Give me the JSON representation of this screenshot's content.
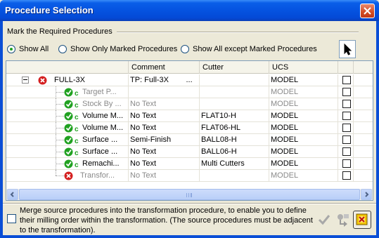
{
  "window": {
    "title": "Procedure Selection"
  },
  "filter": {
    "group_label": "Mark the Required Procedures",
    "options": [
      {
        "label": "Show All",
        "selected": true
      },
      {
        "label": "Show Only Marked Procedures",
        "selected": false
      },
      {
        "label": "Show All except Marked Procedures",
        "selected": false
      }
    ]
  },
  "grid": {
    "columns": [
      "",
      "Comment",
      "Cutter",
      "UCS",
      ""
    ],
    "rows": [
      {
        "name": "FULL-3X",
        "comment": "TP: Full-3X        ...",
        "cutter": "",
        "ucs": "MODEL",
        "icon": "error-icon",
        "level": 0,
        "dim": false,
        "checked": false
      },
      {
        "name": "Target P...",
        "comment": "",
        "cutter": "",
        "ucs": "MODEL",
        "icon": "check-c-icon",
        "level": 1,
        "dim": true,
        "checked": false
      },
      {
        "name": "Stock By ...",
        "comment": "No Text",
        "cutter": "",
        "ucs": "MODEL",
        "icon": "check-c-icon",
        "level": 1,
        "dim": true,
        "checked": false
      },
      {
        "name": "Volume M...",
        "comment": "No Text",
        "cutter": "FLAT10-H",
        "ucs": "MODEL",
        "icon": "check-c-icon",
        "level": 1,
        "dim": false,
        "checked": false
      },
      {
        "name": "Volume M...",
        "comment": "No Text",
        "cutter": "FLAT06-HL",
        "ucs": "MODEL",
        "icon": "check-c-icon",
        "level": 1,
        "dim": false,
        "checked": false
      },
      {
        "name": "Surface ...",
        "comment": "Semi-Finish",
        "cutter": "BALL08-H",
        "ucs": "MODEL",
        "icon": "check-c-icon",
        "level": 1,
        "dim": false,
        "checked": false
      },
      {
        "name": "Surface ...",
        "comment": "No Text",
        "cutter": "BALL06-H",
        "ucs": "MODEL",
        "icon": "check-c-icon",
        "level": 1,
        "dim": false,
        "checked": false
      },
      {
        "name": "Remachi...",
        "comment": "No Text",
        "cutter": "Multi Cutters",
        "ucs": "MODEL",
        "icon": "check-c-icon",
        "level": 1,
        "dim": false,
        "checked": false
      },
      {
        "name": "Transfor...",
        "comment": "No Text",
        "cutter": "",
        "ucs": "MODEL",
        "icon": "error-icon",
        "level": 1,
        "dim": true,
        "checked": false
      }
    ]
  },
  "merge": {
    "text": "Merge source procedures into the transformation procedure, to enable you to define their milling order within the transformation. (The source procedures must be adjacent to the transformation).",
    "checked": false
  },
  "buttons": {
    "ok_icon": "checkmark-icon",
    "apply_icon": "transfer-icon",
    "close_icon": "exit-icon"
  },
  "colors": {
    "title_bar": "#0553e0",
    "error": "#d42020",
    "ok": "#21a121"
  }
}
